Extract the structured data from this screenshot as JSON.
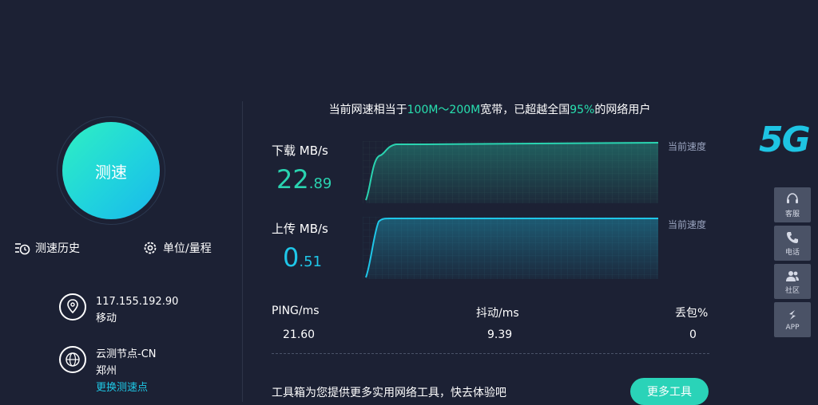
{
  "left": {
    "start_button": "测速",
    "history": "测速历史",
    "unit": "单位/量程",
    "ip": "117.155.192.90",
    "isp": "移动",
    "node": "云测节点-CN",
    "node_city": "郑州",
    "switch_node": "更换测速点"
  },
  "headline": {
    "prefix": "当前网速相当于",
    "bandwidth": "100M～200M",
    "middle": "宽带，已超越全国",
    "percent": "95%",
    "suffix": "的网络用户"
  },
  "download": {
    "label": "下载 MB/s",
    "value_int": "22",
    "value_dec": ".89",
    "curr_label": "当前速度",
    "color": "#2ad3b0"
  },
  "upload": {
    "label": "上传 MB/s",
    "value_int": "0",
    "value_dec": ".51",
    "curr_label": "当前速度",
    "color": "#1fc6e8"
  },
  "stats": {
    "ping_label": "PING/ms",
    "ping": "21.60",
    "jitter_label": "抖动/ms",
    "jitter": "9.39",
    "loss_label": "丢包%",
    "loss": "0"
  },
  "tools": {
    "text": "工具箱为您提供更多实用网络工具，快去体验吧",
    "button": "更多工具"
  },
  "side": {
    "logo": "5G",
    "service": "客服",
    "phone": "电话",
    "community": "社区",
    "app": "APP"
  },
  "colors": {
    "background": "#1c2134",
    "accent_green": "#28e0b0",
    "accent_blue": "#1ec8e6"
  }
}
